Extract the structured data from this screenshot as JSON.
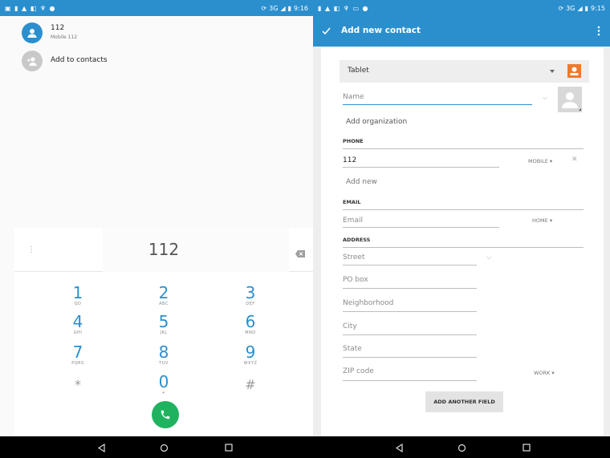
{
  "left": {
    "statusbar": {
      "time": "9:16",
      "network": "3G"
    },
    "contact": {
      "name": "112",
      "subtitle": "Mobile 112"
    },
    "add_contacts_label": "Add to contacts",
    "dialed_number": "112",
    "keys": [
      {
        "n": "1",
        "l": "QD"
      },
      {
        "n": "2",
        "l": "ABC"
      },
      {
        "n": "3",
        "l": "DEF"
      },
      {
        "n": "4",
        "l": "GHI"
      },
      {
        "n": "5",
        "l": "JKL"
      },
      {
        "n": "6",
        "l": "MNO"
      },
      {
        "n": "7",
        "l": "PQRS"
      },
      {
        "n": "8",
        "l": "TUV"
      },
      {
        "n": "9",
        "l": "WXYZ"
      },
      {
        "n": "*",
        "l": ""
      },
      {
        "n": "0",
        "l": "+"
      },
      {
        "n": "#",
        "l": ""
      }
    ]
  },
  "right": {
    "statusbar": {
      "time": "9:15",
      "network": "3G"
    },
    "title": "Add new contact",
    "account": "Tablet",
    "name_placeholder": "Name",
    "add_org": "Add organization",
    "phone_header": "PHONE",
    "phone_value": "112",
    "phone_type": "MOBILE",
    "add_new": "Add new",
    "email_header": "EMAIL",
    "email_placeholder": "Email",
    "email_type": "HOME",
    "address_header": "ADDRESS",
    "street": "Street",
    "pobox": "PO box",
    "neighborhood": "Neighborhood",
    "city": "City",
    "state": "State",
    "zip": "ZIP code",
    "address_type": "WORK",
    "add_field_button": "ADD ANOTHER FIELD"
  },
  "colors": {
    "primary": "#2b8fce",
    "call": "#1fb35f",
    "account": "#ec7a2c"
  }
}
